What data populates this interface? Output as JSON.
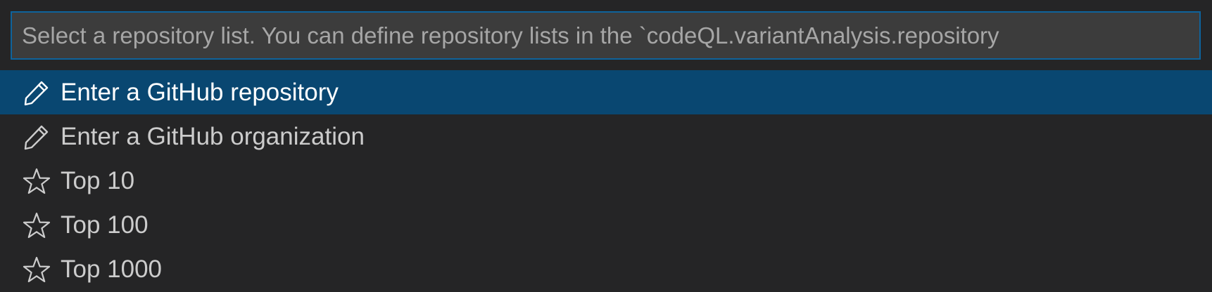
{
  "search": {
    "placeholder": "Select a repository list. You can define repository lists in the `codeQL.variantAnalysis.repository",
    "value": ""
  },
  "items": [
    {
      "label": "Enter a GitHub repository",
      "icon": "pencil-icon",
      "selected": true
    },
    {
      "label": "Enter a GitHub organization",
      "icon": "pencil-icon",
      "selected": false
    },
    {
      "label": "Top 10",
      "icon": "star-icon",
      "selected": false
    },
    {
      "label": "Top 100",
      "icon": "star-icon",
      "selected": false
    },
    {
      "label": "Top 1000",
      "icon": "star-icon",
      "selected": false
    }
  ],
  "colors": {
    "background": "#252526",
    "input_background": "#3c3c3c",
    "focus_border": "#0e639c",
    "selected_background": "#094771",
    "text": "#cccccc",
    "selected_text": "#ffffff"
  }
}
